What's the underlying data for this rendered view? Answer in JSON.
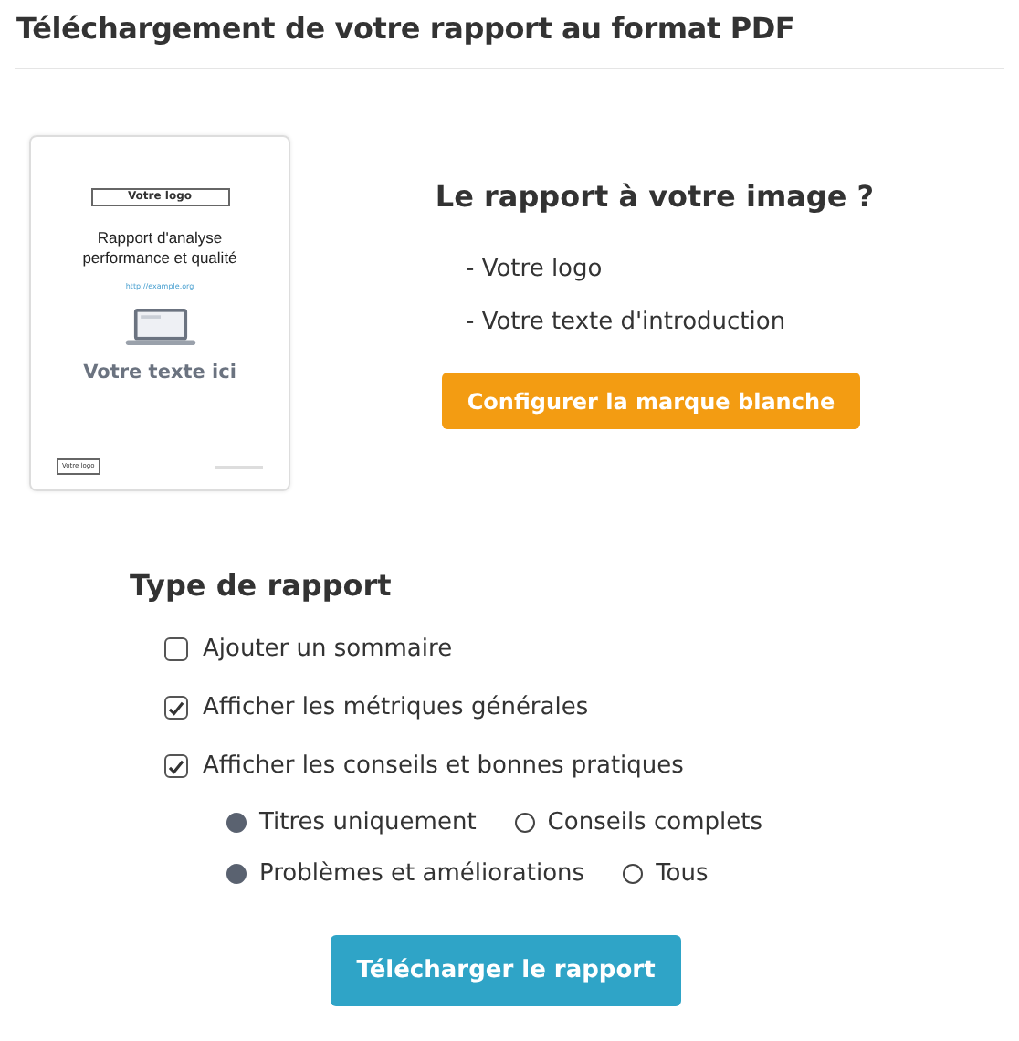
{
  "title": "Téléchargement de votre rapport au format PDF",
  "preview": {
    "logo": "Votre logo",
    "heading": "Rapport d'analyse performance et qualité",
    "url": "http://example.org",
    "text": "Votre texte ici",
    "footer_logo": "Votre logo"
  },
  "branding": {
    "heading": "Le rapport à votre image ?",
    "items": [
      "- Votre logo",
      "- Votre texte d'introduction"
    ],
    "button": "Configurer la marque blanche"
  },
  "report_type": {
    "heading": "Type de rapport",
    "options": [
      {
        "label": "Ajouter un sommaire",
        "checked": false
      },
      {
        "label": "Afficher les métriques générales",
        "checked": true
      },
      {
        "label": "Afficher les conseils et bonnes pratiques",
        "checked": true
      }
    ],
    "radio_groups": [
      [
        {
          "label": "Titres uniquement",
          "selected": true
        },
        {
          "label": "Conseils complets",
          "selected": false
        }
      ],
      [
        {
          "label": "Problèmes et améliorations",
          "selected": true
        },
        {
          "label": "Tous",
          "selected": false
        }
      ]
    ]
  },
  "download_button": "Télécharger le rapport"
}
